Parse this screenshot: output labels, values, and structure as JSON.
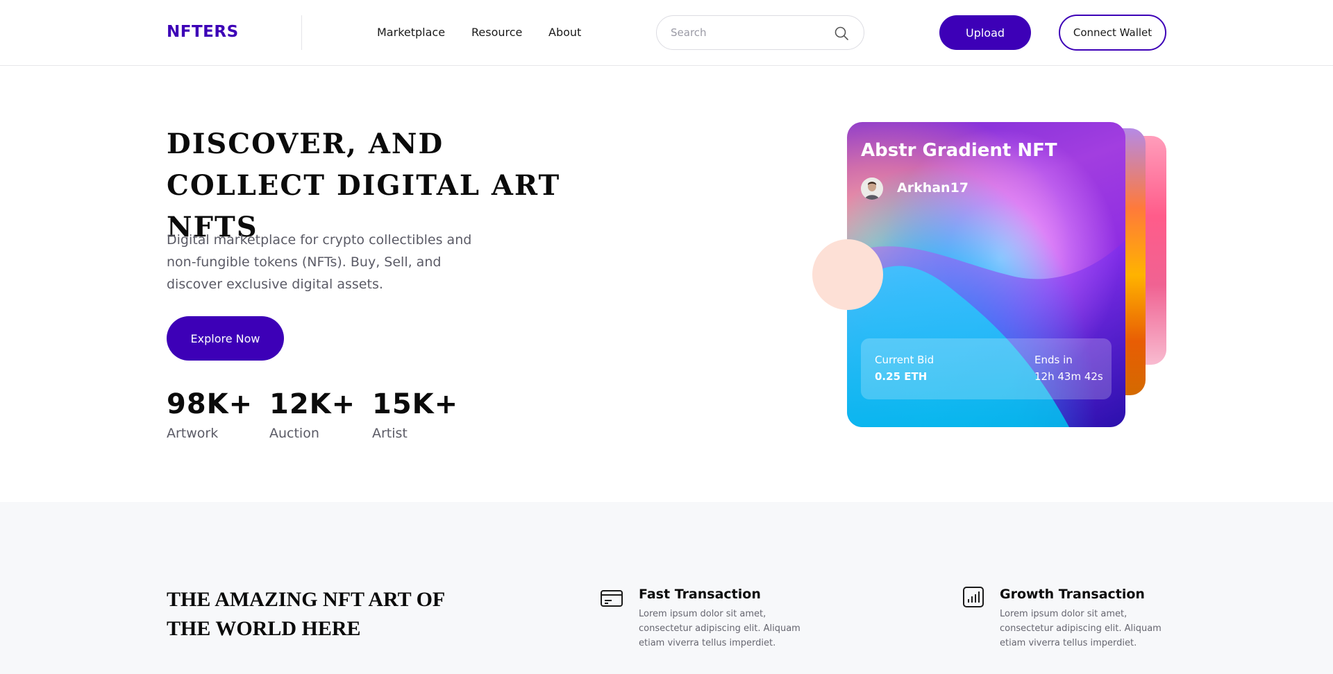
{
  "header": {
    "logo": "NFTERS",
    "nav": [
      "Marketplace",
      "Resource",
      "About"
    ],
    "search_placeholder": "Search",
    "upload_label": "Upload",
    "wallet_label": "Connect Wallet"
  },
  "hero": {
    "title": "DISCOVER, AND COLLECT DIGITAL ART NFTS",
    "description": "Digital marketplace for crypto collectibles and non-fungible tokens (NFTs). Buy, Sell, and discover exclusive digital assets.",
    "cta_label": "Explore Now",
    "stats": [
      {
        "value": "98K+",
        "label": "Artwork"
      },
      {
        "value": "12K+",
        "label": "Auction"
      },
      {
        "value": "15K+",
        "label": "Artist"
      }
    ]
  },
  "card": {
    "title": "Abstr Gradient NFT",
    "creator": "Arkhan17",
    "bid_label": "Current Bid",
    "bid_value": "0.25 ETH",
    "ends_label": "Ends in",
    "ends_value": "12h 43m 42s"
  },
  "section2": {
    "title": "THE AMAZING NFT ART OF THE WORLD HERE",
    "features": [
      {
        "icon": "credit-card-icon",
        "title": "Fast Transaction",
        "desc": "Lorem ipsum dolor sit amet, consectetur adipiscing elit. Aliquam etiam viverra tellus imperdiet."
      },
      {
        "icon": "bar-chart-icon",
        "title": "Growth Transaction",
        "desc": "Lorem ipsum dolor sit amet, consectetur adipiscing elit. Aliquam etiam viverra tellus imperdiet."
      }
    ]
  },
  "colors": {
    "brand": "#3d00b7",
    "section_bg": "#f7f8fa",
    "accent_peach": "#fde0d6"
  }
}
